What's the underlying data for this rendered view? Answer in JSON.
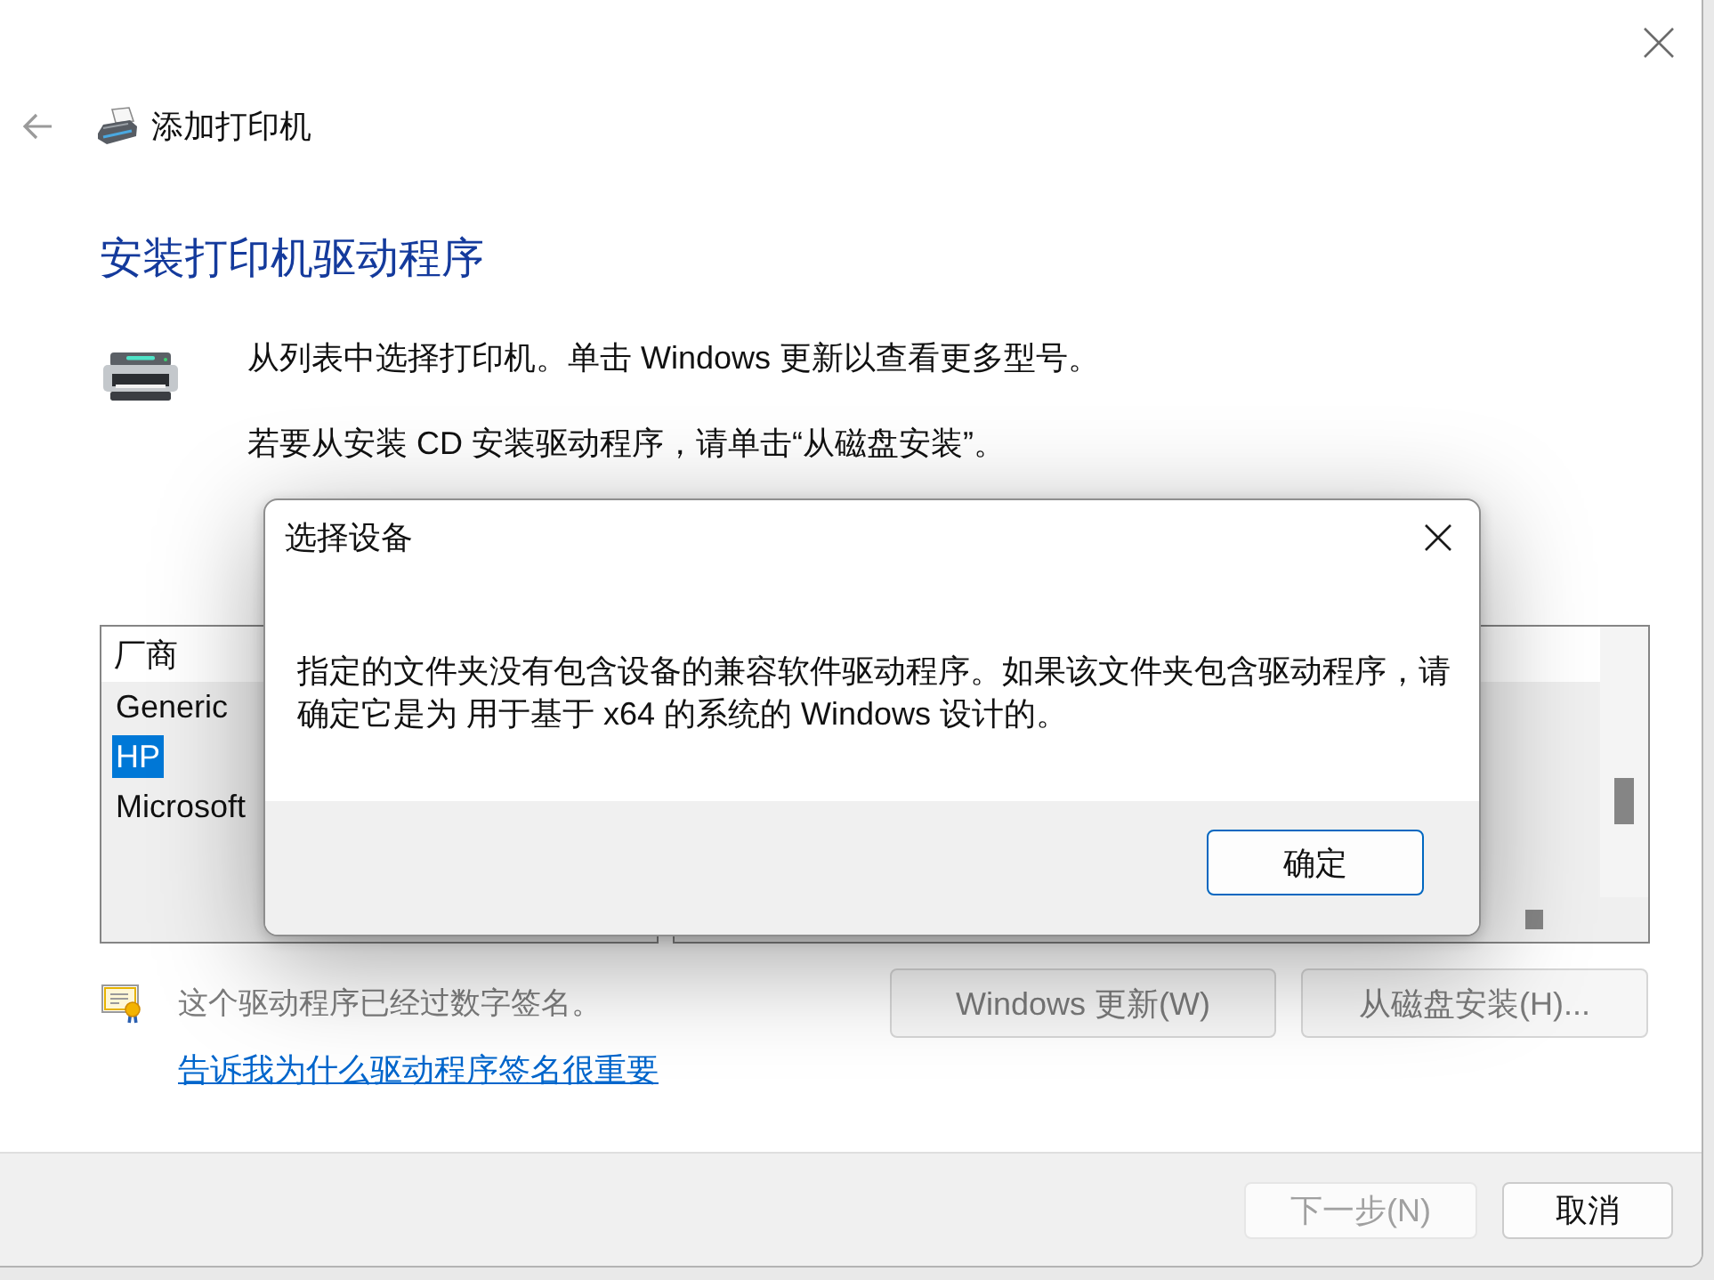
{
  "window": {
    "title": "添加打印机"
  },
  "heading": "安装打印机驱动程序",
  "instructions": [
    "从列表中选择打印机。单击 Windows 更新以查看更多型号。",
    "若要从安装 CD 安装驱动程序，请单击“从磁盘安装”。"
  ],
  "manufacturer_list": {
    "header": "厂商",
    "items": [
      {
        "label": "Generic",
        "selected": false
      },
      {
        "label": "HP",
        "selected": true
      },
      {
        "label": "Microsoft",
        "selected": false
      }
    ]
  },
  "signature_status": {
    "text": "这个驱动程序已经过数字签名。",
    "disabled": true
  },
  "signature_link": "告诉我为什么驱动程序签名很重要",
  "driver_buttons": [
    {
      "label": "Windows 更新(W)",
      "disabled": true
    },
    {
      "label": "从磁盘安装(H)...",
      "disabled": true
    }
  ],
  "footer_buttons": [
    {
      "label": "下一步(N)",
      "disabled": true
    },
    {
      "label": "取消",
      "disabled": false
    }
  ],
  "dialog": {
    "title": "选择设备",
    "message": "指定的文件夹没有包含设备的兼容软件驱动程序。如果该文件夹包含驱动程序，请确定它是为 用于基于 x64 的系统的 Windows 设计的。",
    "buttons": [
      {
        "label": "确定",
        "default": true
      }
    ]
  }
}
